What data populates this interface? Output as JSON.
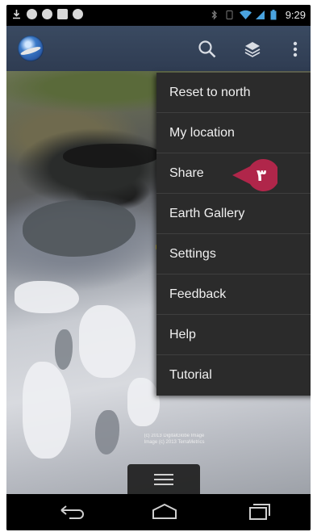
{
  "statusbar": {
    "time": "9:29",
    "left_icons": [
      "download-icon",
      "chat-icon",
      "check-icon",
      "image-icon",
      "game-icon"
    ],
    "right_icons": [
      "bluetooth-icon",
      "rotate-icon",
      "wifi-icon",
      "signal-icon",
      "battery-icon"
    ]
  },
  "actionbar": {
    "logo": "google-earth-logo",
    "icons": [
      "search-icon",
      "layers-icon",
      "overflow-menu-icon"
    ]
  },
  "map": {
    "copyright_lines": [
      "(c) 2013 DigitalGlobe Image",
      "Image (c) 2013 TerraMetrics"
    ]
  },
  "menu": {
    "items": [
      {
        "label": "Reset to north"
      },
      {
        "label": "My location"
      },
      {
        "label": "Share"
      },
      {
        "label": "Earth Gallery"
      },
      {
        "label": "Settings"
      },
      {
        "label": "Feedback"
      },
      {
        "label": "Help"
      },
      {
        "label": "Tutorial"
      }
    ]
  },
  "callout": {
    "number": "٣",
    "color": "#b0264a"
  },
  "navbar": {
    "buttons": [
      "back-icon",
      "home-icon",
      "recent-apps-icon"
    ]
  }
}
